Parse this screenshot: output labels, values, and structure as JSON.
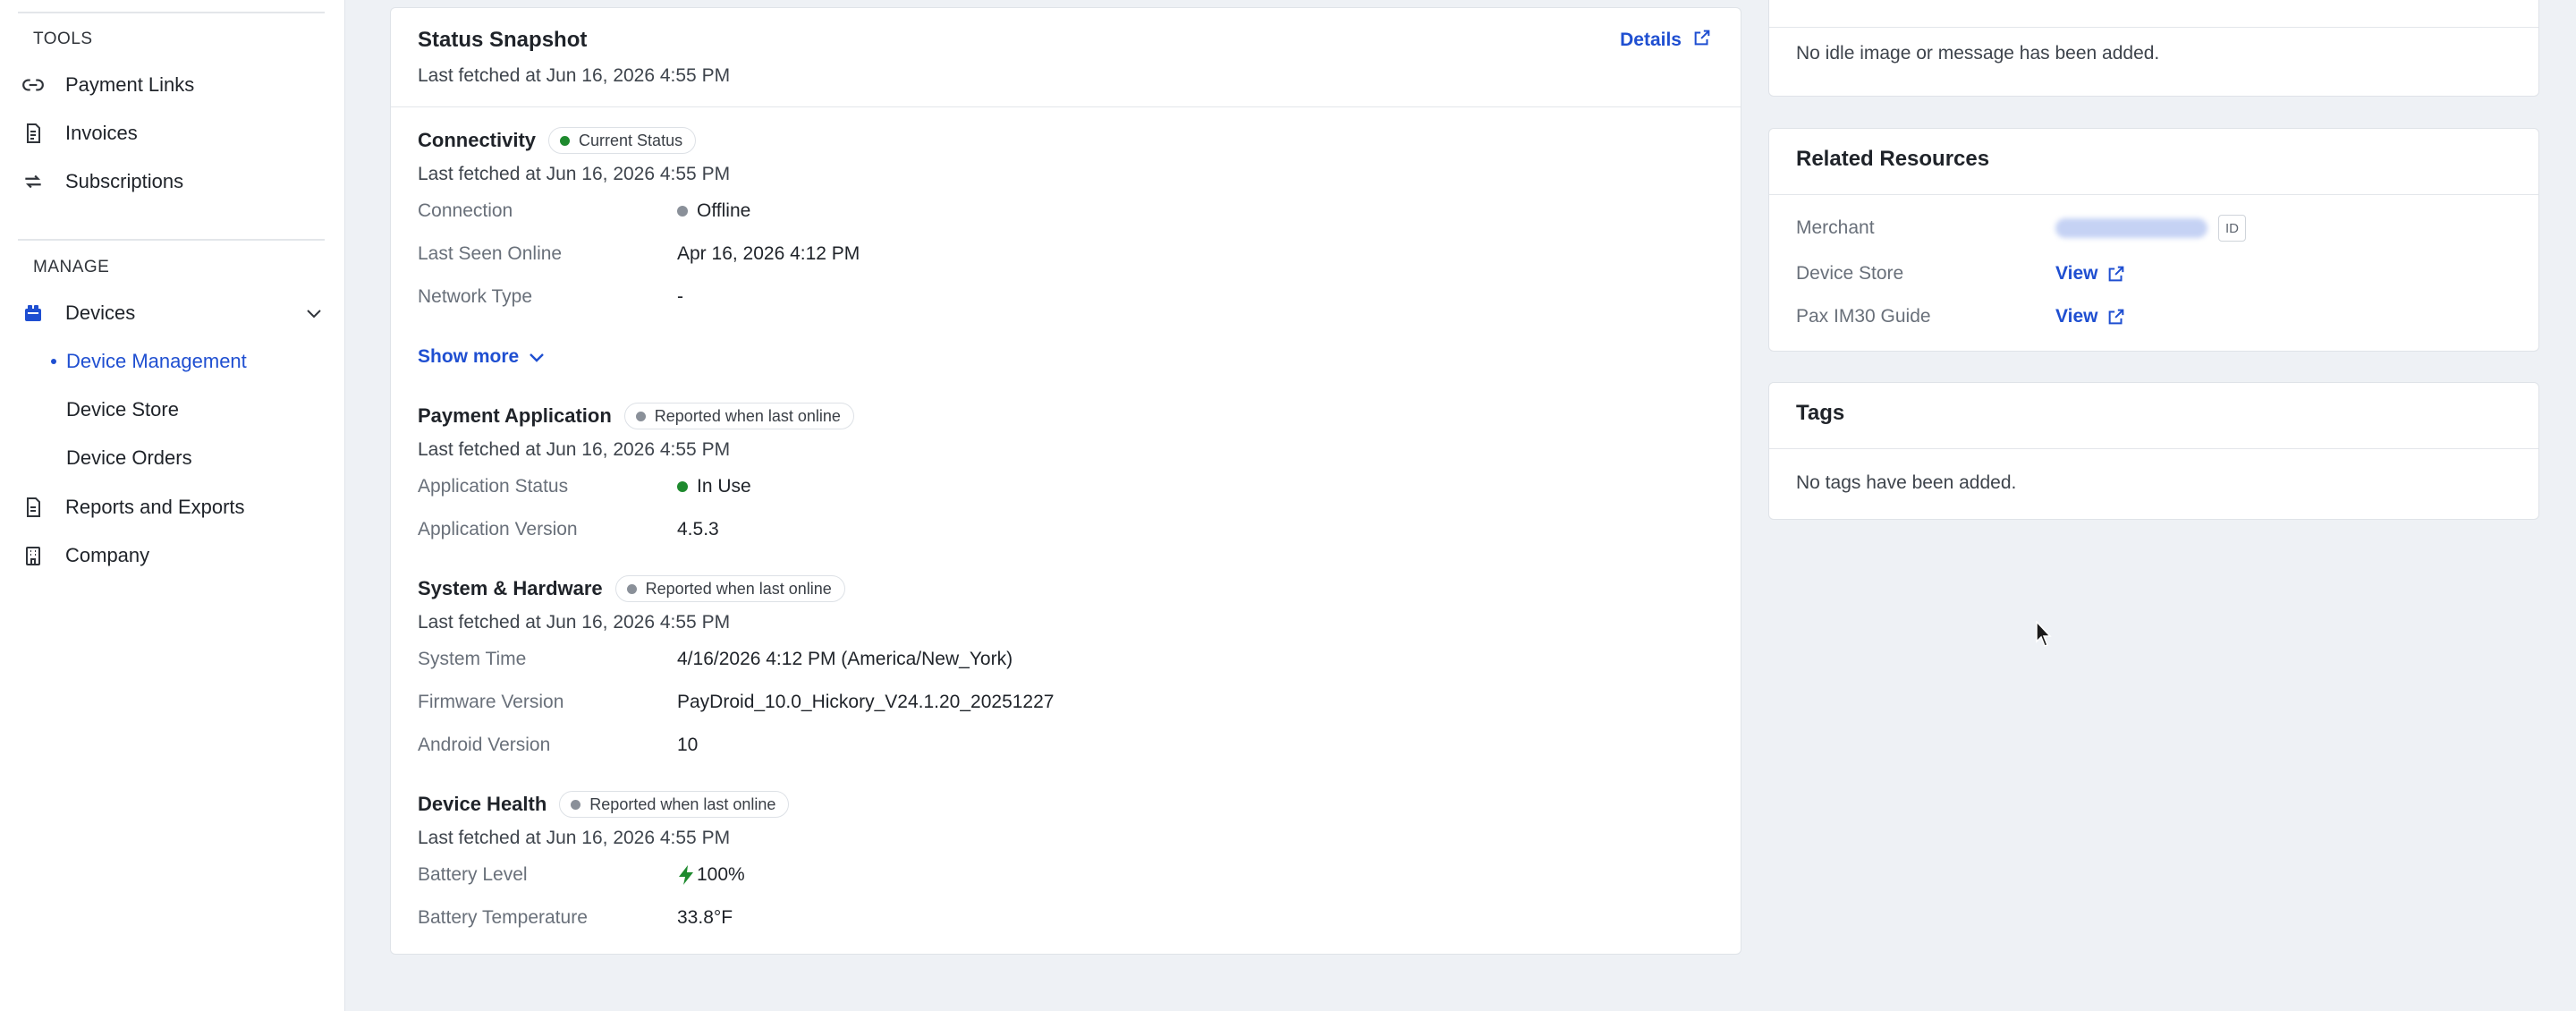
{
  "sidebar": {
    "tools_heading": "TOOLS",
    "tools": [
      {
        "label": "Payment Links",
        "icon": "link-icon"
      },
      {
        "label": "Invoices",
        "icon": "invoice-icon"
      },
      {
        "label": "Subscriptions",
        "icon": "refresh-icon"
      }
    ],
    "manage_heading": "MANAGE",
    "devices_label": "Devices",
    "device_subitems": [
      "Device Management",
      "Device Store",
      "Device Orders"
    ],
    "reports_label": "Reports and Exports",
    "company_label": "Company"
  },
  "snapshot": {
    "title": "Status Snapshot",
    "fetched": "Last fetched at Jun 16, 2026 4:55 PM",
    "details_label": "Details",
    "connectivity": {
      "title": "Connectivity",
      "badge": "Current Status",
      "fetched": "Last fetched at Jun 16, 2026 4:55 PM",
      "rows": [
        {
          "label": "Connection",
          "value": "Offline"
        },
        {
          "label": "Last Seen Online",
          "value": "Apr 16, 2026 4:12 PM"
        },
        {
          "label": "Network Type",
          "value": "-"
        }
      ],
      "show_more": "Show more"
    },
    "payment_app": {
      "title": "Payment Application",
      "badge": "Reported when last online",
      "fetched": "Last fetched at Jun 16, 2026 4:55 PM",
      "rows": [
        {
          "label": "Application Status",
          "value": "In Use"
        },
        {
          "label": "Application Version",
          "value": "4.5.3"
        }
      ]
    },
    "system": {
      "title": "System & Hardware",
      "badge": "Reported when last online",
      "fetched": "Last fetched at Jun 16, 2026 4:55 PM",
      "rows": [
        {
          "label": "System Time",
          "value": "4/16/2026 4:12 PM (America/New_York)"
        },
        {
          "label": "Firmware Version",
          "value": "PayDroid_10.0_Hickory_V24.1.20_20251227"
        },
        {
          "label": "Android Version",
          "value": "10"
        }
      ]
    },
    "health": {
      "title": "Device Health",
      "badge": "Reported when last online",
      "fetched": "Last fetched at Jun 16, 2026 4:55 PM",
      "rows": [
        {
          "label": "Battery Level",
          "value": "100%"
        },
        {
          "label": "Battery Temperature",
          "value": "33.8°F"
        }
      ]
    }
  },
  "idle_screen": {
    "message": "No idle image or message has been added."
  },
  "related": {
    "title": "Related Resources",
    "merchant_label": "Merchant",
    "id_badge": "ID",
    "device_store_label": "Device Store",
    "guide_label": "Pax IM30 Guide",
    "view_label": "View"
  },
  "tags": {
    "title": "Tags",
    "empty": "No tags have been added."
  },
  "colors": {
    "accent": "#1f4fd1",
    "green": "#1e8a2e",
    "gray_dot": "#8a9099"
  }
}
